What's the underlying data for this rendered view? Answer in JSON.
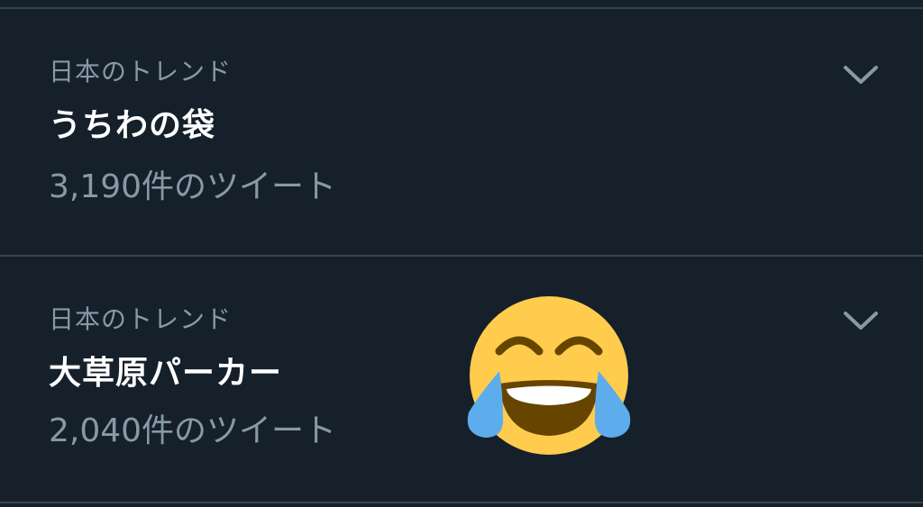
{
  "trends": [
    {
      "context": "日本のトレンド",
      "name": "うちわの袋",
      "count": "3,190件のツイート",
      "menu_icon": "chevron-down-icon"
    },
    {
      "context": "日本のトレンド",
      "name": "大草原パーカー",
      "count": "2,040件のツイート",
      "menu_icon": "chevron-down-icon"
    }
  ],
  "overlay": {
    "icon": "face-with-tears-of-joy-emoji"
  },
  "colors": {
    "background": "#15202b",
    "divider": "#38444d",
    "secondary_text": "#8899a6",
    "primary_text": "#ffffff",
    "emoji_face": "#ffcc4d",
    "emoji_tears": "#5dadec"
  }
}
